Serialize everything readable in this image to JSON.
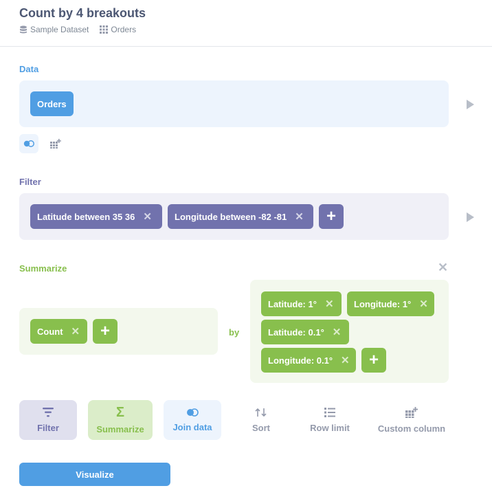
{
  "header": {
    "title": "Count by 4 breakouts",
    "database": "Sample Dataset",
    "table": "Orders"
  },
  "data_step": {
    "label": "Data",
    "table": "Orders"
  },
  "filter_step": {
    "label": "Filter",
    "filters": [
      "Latitude between 35 36",
      "Longitude between -82 -81"
    ]
  },
  "summarize_step": {
    "label": "Summarize",
    "metrics": [
      "Count"
    ],
    "by_label": "by",
    "breakouts": [
      "Latitude: 1°",
      "Longitude: 1°",
      "Latitude: 0.1°",
      "Longitude: 0.1°"
    ]
  },
  "actions": {
    "filter": "Filter",
    "summarize": "Summarize",
    "join": "Join data",
    "sort": "Sort",
    "limit": "Row limit",
    "custom": "Custom column"
  },
  "visualize_label": "Visualize",
  "colors": {
    "brand": "#509ee3",
    "filter": "#7172ad",
    "summarize": "#88bf4d",
    "text": "#4c5773",
    "muted": "#949aab"
  }
}
